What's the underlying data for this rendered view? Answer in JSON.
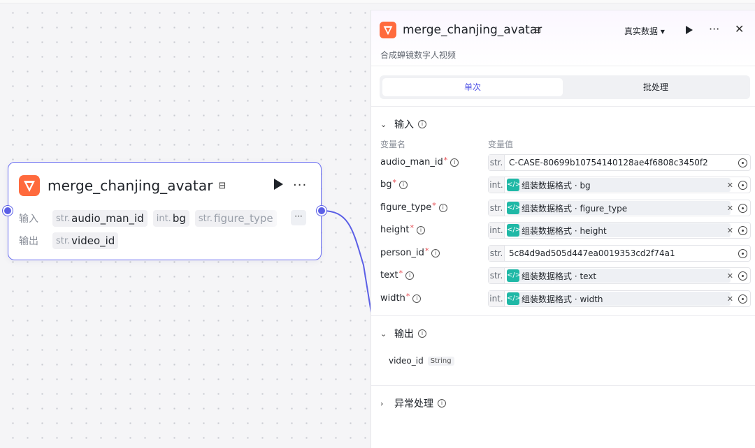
{
  "node": {
    "title": "merge_chanjing_avatar",
    "input_label": "输入",
    "output_label": "输出",
    "inputs": [
      {
        "type": "str.",
        "name": "audio_man_id"
      },
      {
        "type": "int.",
        "name": "bg"
      },
      {
        "type": "str.",
        "name": "figure_type"
      }
    ],
    "more_chip": "···",
    "outputs": [
      {
        "type": "str.",
        "name": "video_id"
      }
    ]
  },
  "panel": {
    "title": "merge_chanjing_avatar",
    "description": "合成蝉镜数字人视频",
    "data_select": "真实数据 ▾",
    "tabs": {
      "single": "单次",
      "batch": "批处理"
    },
    "input_section": {
      "title": "输入",
      "col_name": "变量名",
      "col_value": "变量值",
      "vars": [
        {
          "name": "audio_man_id",
          "type": "str.",
          "kind": "plain",
          "value": "C-CASE-80699b10754140128ae4f6808c3450f2"
        },
        {
          "name": "bg",
          "type": "int.",
          "kind": "ref",
          "value": "组装数据格式 · bg"
        },
        {
          "name": "figure_type",
          "type": "str.",
          "kind": "ref",
          "value": "组装数据格式 · figure_type"
        },
        {
          "name": "height",
          "type": "int.",
          "kind": "ref",
          "value": "组装数据格式 · height"
        },
        {
          "name": "person_id",
          "type": "str.",
          "kind": "plain",
          "value": "5c84d9ad505d447ea0019353cd2f74a1"
        },
        {
          "name": "text",
          "type": "str.",
          "kind": "ref",
          "value": "组装数据格式 · text"
        },
        {
          "name": "width",
          "type": "int.",
          "kind": "ref",
          "value": "组装数据格式 · width"
        }
      ]
    },
    "output_section": {
      "title": "输出",
      "var_name": "video_id",
      "var_type": "String"
    },
    "error_section": {
      "title": "异常处理"
    }
  },
  "colors": {
    "accent": "#5b5fe6",
    "ref_icon": "#1fb8a6",
    "required": "#e5484d"
  }
}
